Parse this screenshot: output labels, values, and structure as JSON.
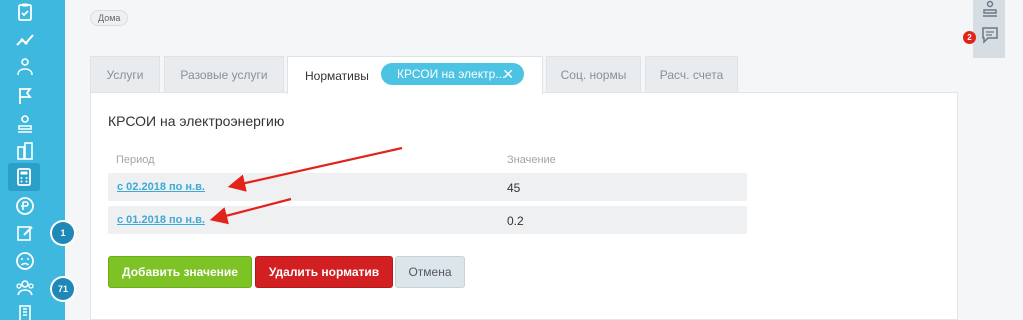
{
  "header": {
    "tag_label": "Дома"
  },
  "sidebar": {
    "items": [
      {
        "icon": "clipboard-check-icon"
      },
      {
        "icon": "chart-line-icon"
      },
      {
        "icon": "users-icon"
      },
      {
        "icon": "flag-icon"
      },
      {
        "icon": "stamp-icon"
      },
      {
        "icon": "buildings-icon"
      },
      {
        "icon": "calculator-icon",
        "active": true
      },
      {
        "icon": "coin-icon"
      },
      {
        "icon": "edit-note-icon",
        "badge": "1"
      },
      {
        "icon": "sad-face-icon"
      },
      {
        "icon": "group-icon",
        "badge": "71"
      },
      {
        "icon": "building-icon"
      }
    ]
  },
  "right_rail": {
    "icons": [
      "stamp-icon",
      "chat-icon"
    ],
    "notification_badge": "2"
  },
  "tabs": [
    {
      "label": "Услуги"
    },
    {
      "label": "Разовые услуги"
    },
    {
      "label": "Нормативы"
    },
    {
      "label": "Соц. нормы"
    },
    {
      "label": "Расч. счета"
    }
  ],
  "active_pill": {
    "label": "КРСОИ на электр..."
  },
  "panel": {
    "title": "КРСОИ на электроэнергию",
    "columns": [
      "Период",
      "Значение"
    ],
    "rows": [
      {
        "period": "с 02.2018 по н.в.",
        "value": "45"
      },
      {
        "period": "с 01.2018 по н.в.",
        "value": "0.2"
      }
    ],
    "buttons": {
      "add": "Добавить значение",
      "delete": "Удалить норматив",
      "cancel": "Отмена"
    }
  },
  "colors": {
    "sidebar": "#3fb8e0",
    "accent": "#4cc3e3",
    "add_button": "#7dc325",
    "delete_button": "#d11f22",
    "annotation_arrow": "#e2231a"
  }
}
